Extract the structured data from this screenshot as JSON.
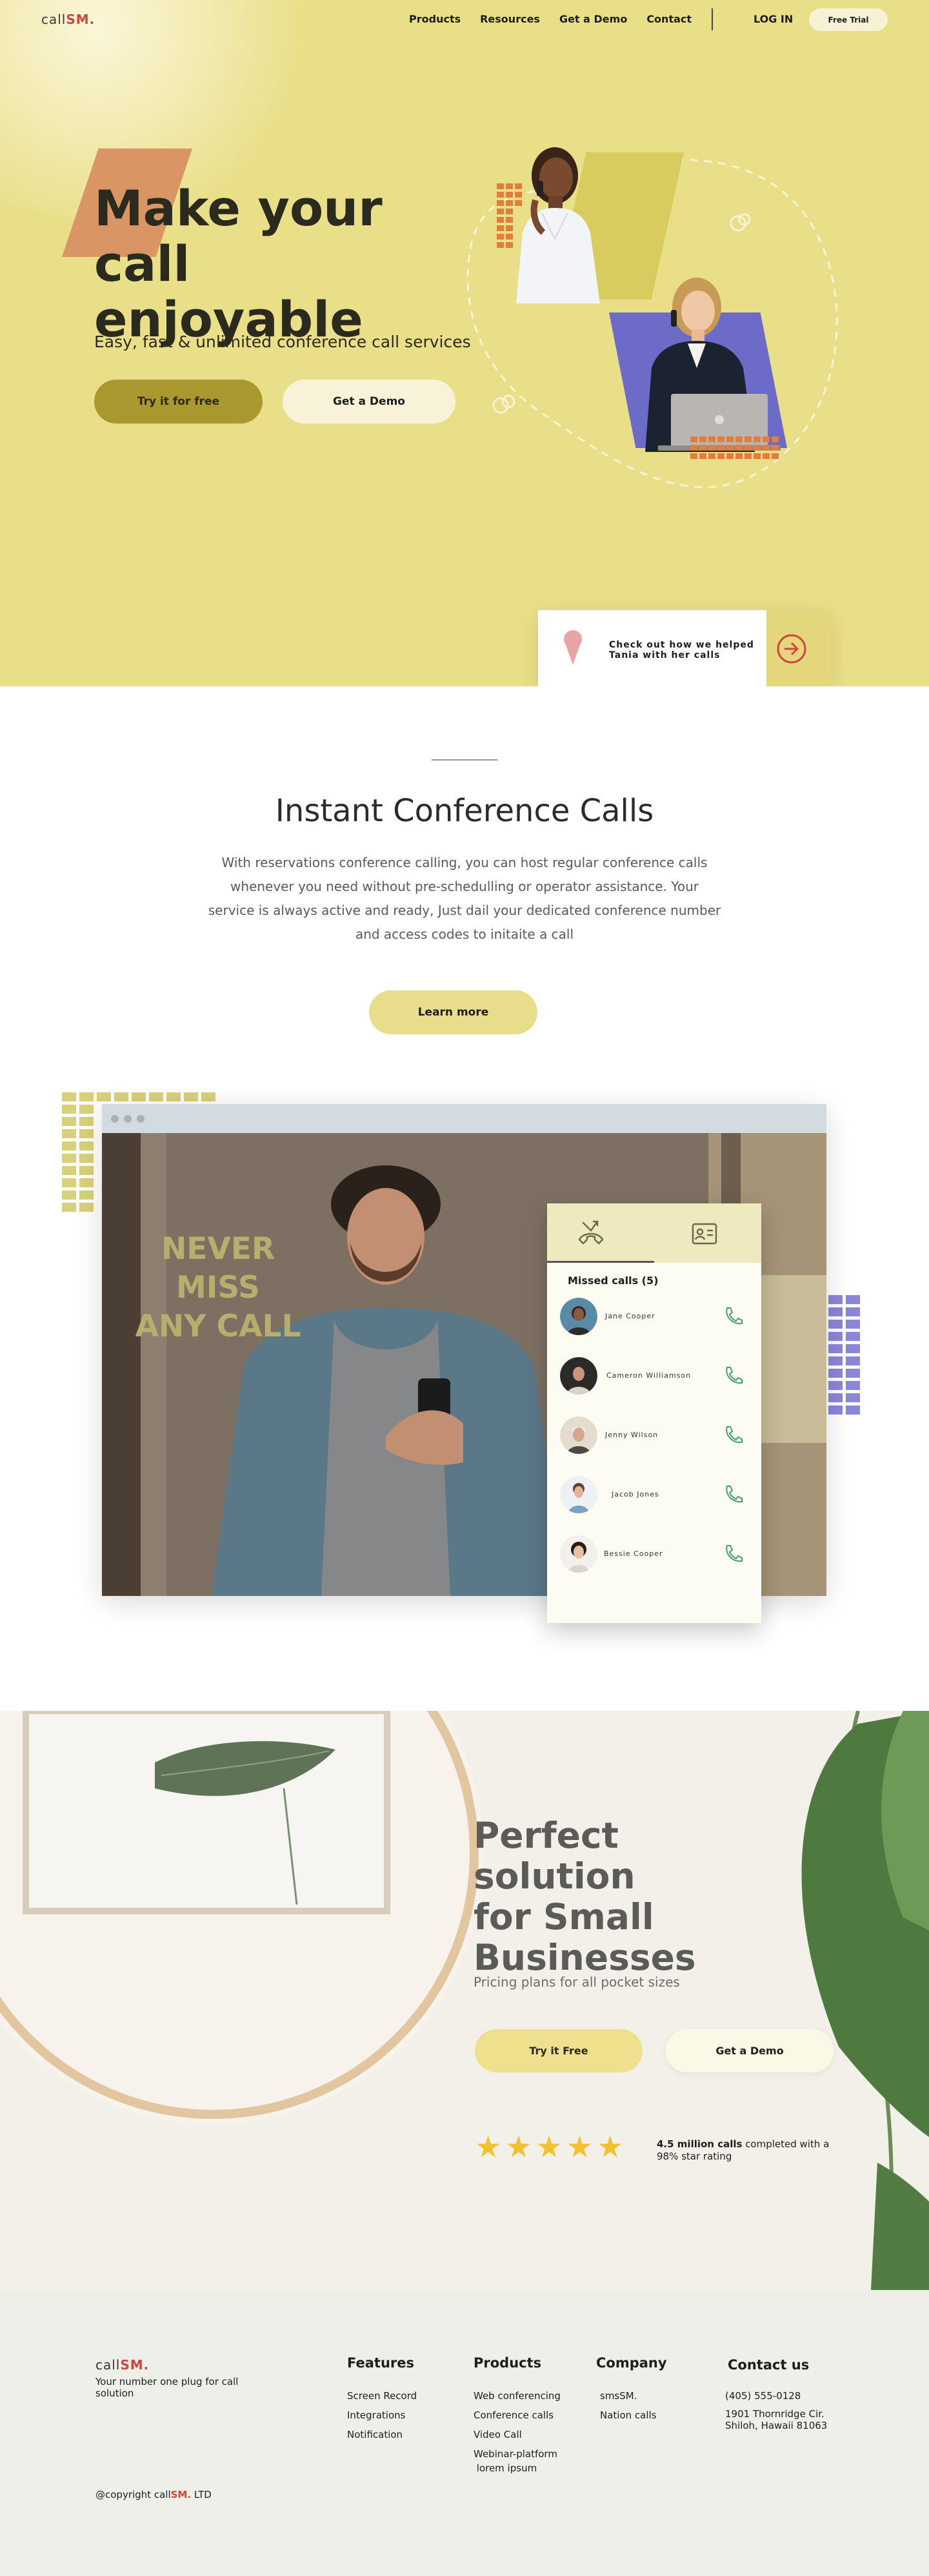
{
  "nav": {
    "logo_prefix": "call",
    "logo_suffix": "SM.",
    "links": [
      "Products",
      "Resources",
      "Get a Demo",
      "Contact"
    ],
    "login": "LOG IN",
    "trial": "Free Trial"
  },
  "hero": {
    "title_line1": "Make your call",
    "title_line2": "enjoyable",
    "subtitle": "Easy, fast & unlimited conference call services",
    "primary_button": "Try it for free",
    "secondary_button": "Get a Demo",
    "story_text": "Check out how we helped Tania with her calls"
  },
  "conference": {
    "title": "Instant Conference Calls",
    "body": "With reservations conference calling, you can host regular conference calls whenever you need without pre-schedulling or operator assistance. Your service is always active and ready, Just dail your dedicated conference number and access codes to initaite a call",
    "button": "Learn more",
    "overlay_line1": "NEVER MISS",
    "overlay_line2": "ANY CALL",
    "missed_title": "Missed calls (5)",
    "contacts": [
      "Jane Cooper",
      "Cameron Williamson",
      "Jenny Wilson",
      "Jacob Jones",
      "Bessie Cooper"
    ]
  },
  "business": {
    "title_line1": "Perfect solution",
    "title_line2": "for Small",
    "title_line3": "Businesses",
    "subtitle": "Pricing plans for all pocket sizes",
    "primary_button": "Try it Free",
    "secondary_button": "Get a Demo",
    "star_count": 5,
    "rating_bold": "4.5 million calls",
    "rating_rest": " completed with a 98% star rating"
  },
  "footer": {
    "logo_prefix": "call",
    "logo_suffix": "SM.",
    "tagline": "Your number one plug for call solution",
    "features_head": "Features",
    "features": [
      "Screen Record",
      "Integrations",
      "Notification"
    ],
    "products_head": "Products",
    "products": [
      "Web conferencing",
      "Conference calls",
      "Video Call",
      "Webinar-platform",
      " lorem ipsum"
    ],
    "company_head": "Company",
    "company": [
      "smsSM.",
      "Nation calls"
    ],
    "contact_head": "Contact us",
    "phone": "(405) 555-0128",
    "address": "1901 Thornridge Cir. Shiloh, Hawaii 81063",
    "copy_prefix": "@copyright call",
    "copy_brand": "SM.",
    "copy_suffix": " LTD"
  },
  "colors": {
    "hero_bg": "#e9df89",
    "olive": "#a8982d",
    "brand_red": "#d0463c",
    "accent_purple": "#7b78d0",
    "accent_orange": "#d99563",
    "phone_green": "#3f9b7a"
  }
}
